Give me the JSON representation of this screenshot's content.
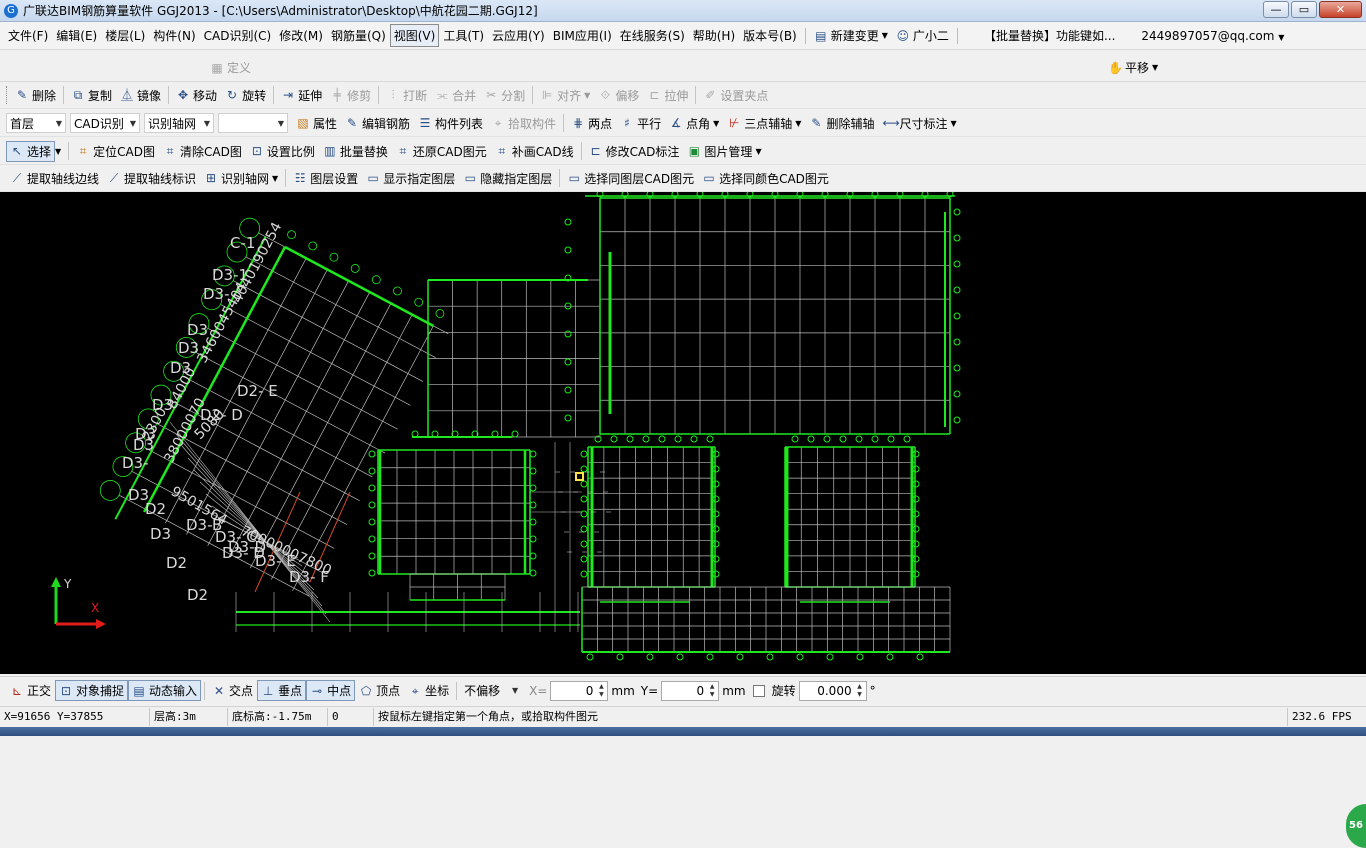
{
  "window": {
    "title": "广联达BIM钢筋算量软件 GGJ2013 - [C:\\Users\\Administrator\\Desktop\\中航花园二期.GGJ12]",
    "minimize": "—",
    "maximize": "▭",
    "close": "✕"
  },
  "menu": {
    "items": [
      "文件(F)",
      "编辑(E)",
      "楼层(L)",
      "构件(N)",
      "CAD识别(C)",
      "修改(M)",
      "钢筋量(Q)",
      "视图(V)",
      "工具(T)",
      "云应用(Y)",
      "BIM应用(I)",
      "在线服务(S)",
      "帮助(H)",
      "版本号(B)"
    ],
    "new_change": "新建变更",
    "assistant": "广小二",
    "batch_replace_hint": "【批量替换】功能键如...",
    "account": "2449897057@qq.com"
  },
  "tabrow": {
    "define": "定义",
    "pan": "平移"
  },
  "toolbar1": {
    "delete": "删除",
    "copy": "复制",
    "mirror": "镜像",
    "move": "移动",
    "rotate": "旋转",
    "extend": "延伸",
    "trim": "修剪",
    "break": "打断",
    "merge": "合并",
    "split": "分割",
    "align": "对齐",
    "offset": "偏移",
    "stretch": "拉伸",
    "grip": "设置夹点"
  },
  "toolbar2": {
    "floor": "首层",
    "cad_recognize": "CAD识别",
    "axis_grid": "识别轴网",
    "blank": "",
    "properties": "属性",
    "edit_rebar": "编辑钢筋",
    "component_list": "构件列表",
    "pick_component": "拾取构件",
    "two_points": "两点",
    "parallel": "平行",
    "point_angle": "点角",
    "three_point_aux": "三点辅轴",
    "delete_aux": "删除辅轴",
    "dimension": "尺寸标注"
  },
  "toolbar3": {
    "select": "选择",
    "locate_cad": "定位CAD图",
    "clear_cad": "清除CAD图",
    "set_scale": "设置比例",
    "batch_replace": "批量替换",
    "restore_cad": "还原CAD图元",
    "draw_cad_line": "补画CAD线",
    "modify_cad_label": "修改CAD标注",
    "image_manage": "图片管理"
  },
  "toolbar4": {
    "extract_axis_lines": "提取轴线边线",
    "extract_axis_labels": "提取轴线标识",
    "recognize_axis_grid": "识别轴网",
    "layer_settings": "图层设置",
    "show_layer": "显示指定图层",
    "hide_layer": "隐藏指定图层",
    "select_same_layer": "选择同图层CAD图元",
    "select_same_color": "选择同颜色CAD图元"
  },
  "canvas": {
    "axis_labels": [
      "C-1",
      "D3-1",
      "D3-",
      "D3",
      "D3",
      "D3",
      "D3",
      "D3",
      "D3",
      "D3-",
      "D3",
      "D2",
      "D3",
      "D2",
      "D2",
      "D3-D",
      "D2- E",
      "D2- D",
      "D3-B",
      "D3- C",
      "D3- D",
      "D3- E",
      "D3- F"
    ],
    "dim_texts": [
      "4040190254",
      "3460045404",
      "84000",
      "2300",
      "38000070",
      "5080",
      "9501564",
      "70000007800"
    ],
    "axis_y": "Y",
    "axis_x": "X",
    "colors": {
      "grid_green": "#1fe81f",
      "grid_white": "#bdbdbd",
      "text": "#d9d9d9",
      "axis_y": "#1fd81f",
      "axis_x": "#e21b1b",
      "marker": "#ffe24a"
    }
  },
  "snapbar": {
    "ortho": "正交",
    "object_snap": "对象捕捉",
    "dynamic_input": "动态输入",
    "intersection": "交点",
    "perpendicular": "垂点",
    "midpoint": "中点",
    "vertex": "顶点",
    "coordinate": "坐标",
    "offset_mode": "不偏移",
    "x_label": "X=",
    "x_value": "0",
    "y_label": "Y=",
    "y_value": "0",
    "unit": "mm",
    "rotate_label": "旋转",
    "rotate_value": "0.000",
    "degree": "°"
  },
  "infobar": {
    "coords": "X=91656 Y=37855",
    "floor_height": "层高:3m",
    "base_height": "底标高:-1.75m",
    "count": "0",
    "hint": "按鼠标左键指定第一个角点，或拾取构件图元",
    "fps": "232.6 FPS"
  },
  "badge": "56"
}
